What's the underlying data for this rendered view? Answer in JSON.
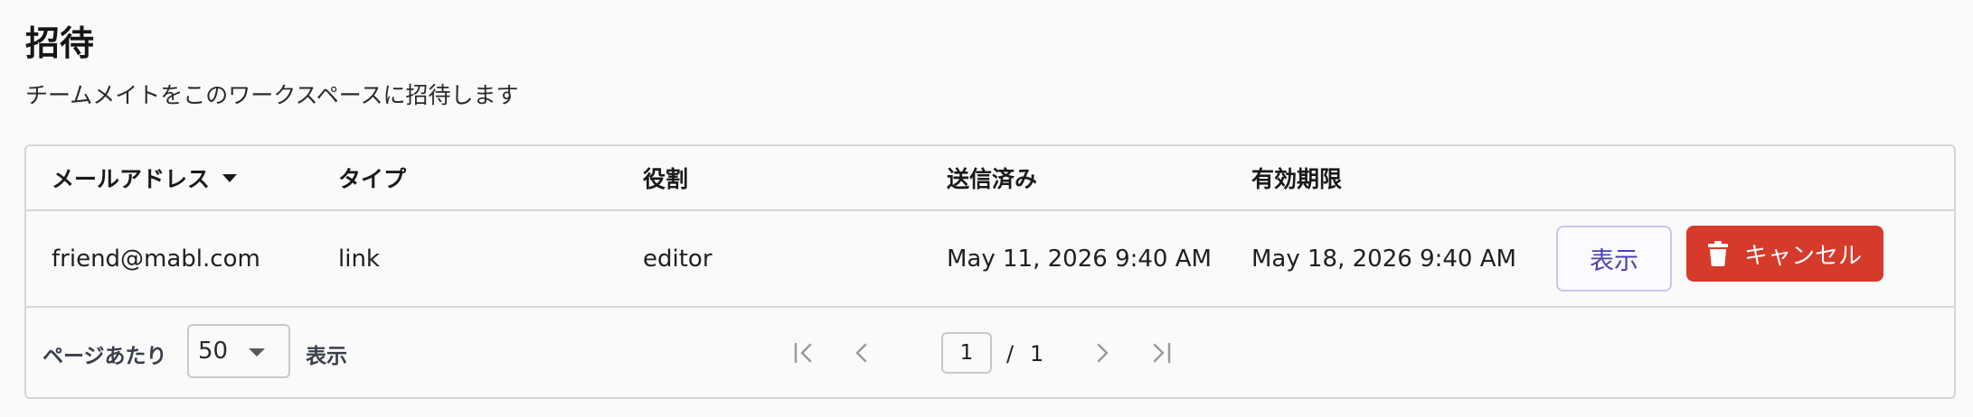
{
  "page": {
    "title": "招待",
    "subtitle": "チームメイトをこのワークスペースに招待します"
  },
  "table": {
    "columns": {
      "email": "メールアドレス",
      "type": "タイプ",
      "role": "役割",
      "sent": "送信済み",
      "expires": "有効期限"
    },
    "rows": [
      {
        "email": "friend@mabl.com",
        "type": "link",
        "role": "editor",
        "sent": "May 11, 2026 9:40 AM",
        "expires": "May 18, 2026 9:40 AM",
        "view_label": "表示",
        "cancel_label": "キャンセル"
      }
    ]
  },
  "pagination": {
    "per_page_label": "ページあたり",
    "per_page_value": "50",
    "show_label": "表示",
    "current_page": "1",
    "separator": "/",
    "total_pages": "1"
  },
  "colors": {
    "accent": "#4b3fb3",
    "danger": "#d63a2a"
  },
  "icons": [
    "sort-desc-icon",
    "trash-icon",
    "chevron-down-icon",
    "first-page-icon",
    "prev-page-icon",
    "next-page-icon",
    "last-page-icon"
  ]
}
